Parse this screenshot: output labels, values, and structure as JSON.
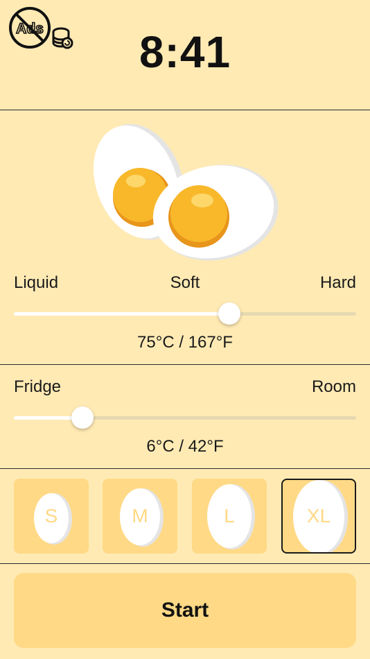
{
  "header": {
    "time": "8:41",
    "ads_icon_text": "Ads",
    "ads_icon": "no-ads-coins-icon"
  },
  "doneness": {
    "labels": [
      "Liquid",
      "Soft",
      "Hard"
    ],
    "value_fraction": 0.63,
    "readout": "75°C / 167°F"
  },
  "start_temp": {
    "labels": [
      "Fridge",
      "Room"
    ],
    "value_fraction": 0.2,
    "readout": "6°C / 42°F"
  },
  "sizes": {
    "items": [
      "S",
      "M",
      "L",
      "XL"
    ],
    "selected": "XL"
  },
  "start_button": {
    "label": "Start"
  },
  "colors": {
    "background": "#FFEAB4",
    "tile": "#FFD985",
    "yolk": "#F8B82A"
  }
}
